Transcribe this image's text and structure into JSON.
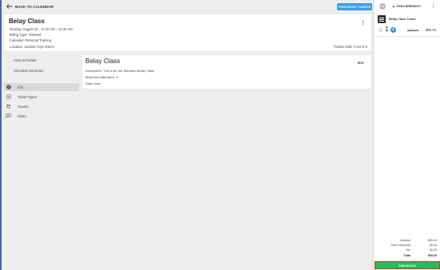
{
  "topbar": {
    "back_label": "BACK TO CALENDAR",
    "purchase_label": "PURCHASE TICKETS"
  },
  "event": {
    "title": "Belay Class",
    "datetime": "Monday, August 30  ·  11:00 AM – 11:30 AM",
    "billing_type": "Billing Type: Ticketed",
    "calendar": "Calendar: Personal Training",
    "location": "Location: Jackson Gym Demo",
    "tickets_sold": "Tickets Sold: 0 out of 6"
  },
  "nav": {
    "links": [
      "View Schedule",
      "Schedule Summary"
    ],
    "items": [
      {
        "label": "Info",
        "icon": "info-icon",
        "active": true
      },
      {
        "label": "Ticket Types",
        "icon": "ticket-types-icon",
        "active": false
      },
      {
        "label": "Guests",
        "icon": "guests-icon",
        "active": false
      },
      {
        "label": "Notes",
        "icon": "notes-icon",
        "active": false
      }
    ]
  },
  "details": {
    "title": "Belay Class",
    "edit_label": "EDIT",
    "description": "Description:  This is for our Standard Belay Class",
    "max_attendees": "Maximum Attendees: 6",
    "staff": "Staff: none"
  },
  "cart": {
    "avatar_initials": "R B",
    "user_name": "RYAN BRENNICH",
    "ticket_name": "Belay Class Ticket",
    "quantity": "1",
    "original_price": "@$95.00",
    "price": "$95.00",
    "subtotal_label": "Subtotal",
    "subtotal_value": "$95.00",
    "discounts_label": "Total Discounts",
    "discounts_value": "$0.00",
    "tax_label": "Tax",
    "tax_value": "$0.00",
    "total_label": "Total",
    "total_value": "$95.00",
    "checkout_label": "CHECKOUT"
  },
  "colors": {
    "accent_blue": "#3a9ee8",
    "checkout_green": "#1fbf5c",
    "checkout_border": "#c23b22"
  }
}
